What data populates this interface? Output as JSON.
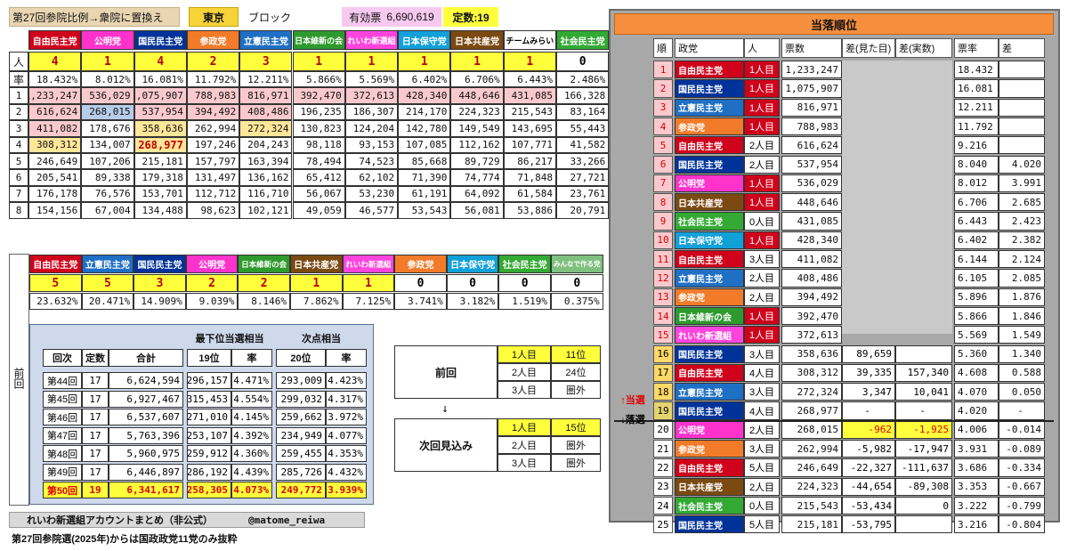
{
  "header": {
    "title": "第27回参院比例→衆院に置換え",
    "block_name": "東京",
    "block_suffix": "ブロック",
    "valid_label": "有効票",
    "valid_votes": "6,690,619",
    "seats_label": "定数:19"
  },
  "colors": {
    "自由民主党": "#d0021b",
    "公明党": "#ff33cc",
    "国民民主党": "#003399",
    "参政党": "#f27b2a",
    "立憲民主党": "#1f6fc4",
    "日本維新の会": "#2e9a2e",
    "れいわ新選組": "#ff44dd",
    "日本保守党": "#12a0d8",
    "日本共産党": "#7b4a12",
    "チームみらい": "#ffffff",
    "社会民主党": "#33aa33",
    "みんなで作る党": "#7fc07f"
  },
  "top_table": {
    "parties": [
      "自由民主党",
      "公明党",
      "国民民主党",
      "参政党",
      "立憲民主党",
      "日本維新の会",
      "れいわ新選組",
      "日本保守党",
      "日本共産党",
      "チームみらい",
      "社会民主党"
    ],
    "seats_label": "人",
    "seats": [
      "4",
      "1",
      "4",
      "2",
      "3",
      "1",
      "1",
      "1",
      "1",
      "1",
      "0"
    ],
    "rate_label": "率",
    "rates": [
      "18.432%",
      "8.012%",
      "16.081%",
      "11.792%",
      "12.211%",
      "5.866%",
      "5.569%",
      "6.402%",
      "6.706%",
      "6.443%",
      "2.486%"
    ],
    "rows": [
      {
        "n": "1",
        "v": [
          "1,233,247",
          "536,029",
          "1,075,907",
          "788,983",
          "816,971",
          "392,470",
          "372,613",
          "428,340",
          "448,646",
          "431,085",
          "166,328"
        ]
      },
      {
        "n": "2",
        "v": [
          "616,624",
          "268,015",
          "537,954",
          "394,492",
          "408,486",
          "196,235",
          "186,307",
          "214,170",
          "224,323",
          "215,543",
          "83,164"
        ]
      },
      {
        "n": "3",
        "v": [
          "411,082",
          "178,676",
          "358,636",
          "262,994",
          "272,324",
          "130,823",
          "124,204",
          "142,780",
          "149,549",
          "143,695",
          "55,443"
        ]
      },
      {
        "n": "4",
        "v": [
          "308,312",
          "134,007",
          "268,977",
          "197,246",
          "204,243",
          "98,118",
          "93,153",
          "107,085",
          "112,162",
          "107,771",
          "41,582"
        ]
      },
      {
        "n": "5",
        "v": [
          "246,649",
          "107,206",
          "215,181",
          "157,797",
          "163,394",
          "78,494",
          "74,523",
          "85,668",
          "89,729",
          "86,217",
          "33,266"
        ]
      },
      {
        "n": "6",
        "v": [
          "205,541",
          "89,338",
          "179,318",
          "131,497",
          "136,162",
          "65,412",
          "62,102",
          "71,390",
          "74,774",
          "71,848",
          "27,721"
        ]
      },
      {
        "n": "7",
        "v": [
          "176,178",
          "76,576",
          "153,701",
          "112,712",
          "116,710",
          "56,067",
          "53,230",
          "61,191",
          "64,092",
          "61,584",
          "23,761"
        ]
      },
      {
        "n": "8",
        "v": [
          "154,156",
          "67,004",
          "134,488",
          "98,623",
          "102,121",
          "49,059",
          "46,577",
          "53,543",
          "56,081",
          "53,886",
          "20,791"
        ]
      }
    ]
  },
  "prev_table": {
    "side_label": "前回",
    "parties": [
      "自由民主党",
      "立憲民主党",
      "国民民主党",
      "公明党",
      "日本維新の会",
      "日本共産党",
      "れいわ新選組",
      "参政党",
      "日本保守党",
      "社会民主党",
      "みんなで作る党"
    ],
    "seats": [
      "5",
      "5",
      "3",
      "2",
      "2",
      "1",
      "1",
      "0",
      "0",
      "0",
      "0"
    ],
    "rates": [
      "23.632%",
      "20.471%",
      "14.909%",
      "9.039%",
      "8.146%",
      "7.862%",
      "7.125%",
      "3.741%",
      "3.182%",
      "1.519%",
      "0.375%"
    ]
  },
  "history": {
    "h_round": "回次",
    "h_seats": "定数",
    "h_total": "合計",
    "h_group1": "最下位当選相当",
    "h_group2": "次点相当",
    "h_pos1": "19位",
    "h_rate1": "率",
    "h_pos2": "20位",
    "h_rate2": "率",
    "rows": [
      {
        "round": "第44回",
        "seats": "17",
        "total": "6,624,594",
        "v1": "296,157",
        "r1": "4.471%",
        "v2": "293,009",
        "r2": "4.423%"
      },
      {
        "round": "第45回",
        "seats": "17",
        "total": "6,927,467",
        "v1": "315,453",
        "r1": "4.554%",
        "v2": "299,032",
        "r2": "4.317%"
      },
      {
        "round": "第46回",
        "seats": "17",
        "total": "6,537,607",
        "v1": "271,010",
        "r1": "4.145%",
        "v2": "259,662",
        "r2": "3.972%"
      },
      {
        "round": "第47回",
        "seats": "17",
        "total": "5,763,396",
        "v1": "253,107",
        "r1": "4.392%",
        "v2": "234,949",
        "r2": "4.077%"
      },
      {
        "round": "第48回",
        "seats": "17",
        "total": "5,960,975",
        "v1": "259,912",
        "r1": "4.360%",
        "v2": "259,455",
        "r2": "4.353%"
      },
      {
        "round": "第49回",
        "seats": "17",
        "total": "6,446,897",
        "v1": "286,192",
        "r1": "4.439%",
        "v2": "285,726",
        "r2": "4.432%"
      },
      {
        "round": "第50回",
        "seats": "19",
        "total": "6,341,617",
        "v1": "258,305",
        "r1": "4.073%",
        "v2": "249,772",
        "r2": "3.939%"
      }
    ]
  },
  "comparison": {
    "prev_label": "前回",
    "next_label": "次回見込み",
    "arrow": "↓",
    "prev": [
      {
        "count": "1人目",
        "rank": "11位"
      },
      {
        "count": "2人目",
        "rank": "24位"
      },
      {
        "count": "3人目",
        "rank": "圏外"
      }
    ],
    "next": [
      {
        "count": "1人目",
        "rank": "15位"
      },
      {
        "count": "2人目",
        "rank": "圏外"
      },
      {
        "count": "3人目",
        "rank": "圏外"
      }
    ]
  },
  "footer": {
    "account": "れいわ新選組アカウントまとめ（非公式）",
    "handle": "@matome_reiwa",
    "note": "第27回参院選(2025年)からは国政政党11党のみ抜粋"
  },
  "ranking": {
    "title": "当落順位",
    "headers": {
      "rank": "順",
      "party": "政党",
      "person": "人",
      "votes": "票数",
      "diff_seen": "差(見た目)",
      "diff_real": "差(実数)",
      "rate": "票率",
      "diff": "差"
    },
    "win_label": "↑当選",
    "lose_label": "↓落選",
    "rows": [
      {
        "rank": "1",
        "party": "自由民主党",
        "person": "1人目",
        "votes": "1,233,247",
        "diff_seen": "",
        "diff_real": "",
        "rate": "18.432",
        "diff": ""
      },
      {
        "rank": "2",
        "party": "国民民主党",
        "person": "1人目",
        "votes": "1,075,907",
        "diff_seen": "",
        "diff_real": "",
        "rate": "16.081",
        "diff": ""
      },
      {
        "rank": "3",
        "party": "立憲民主党",
        "person": "1人目",
        "votes": "816,971",
        "diff_seen": "",
        "diff_real": "",
        "rate": "12.211",
        "diff": ""
      },
      {
        "rank": "4",
        "party": "参政党",
        "person": "1人目",
        "votes": "788,983",
        "diff_seen": "",
        "diff_real": "",
        "rate": "11.792",
        "diff": ""
      },
      {
        "rank": "5",
        "party": "自由民主党",
        "person": "2人目",
        "votes": "616,624",
        "diff_seen": "",
        "diff_real": "",
        "rate": "9.216",
        "diff": ""
      },
      {
        "rank": "6",
        "party": "国民民主党",
        "person": "2人目",
        "votes": "537,954",
        "diff_seen": "",
        "diff_real": "",
        "rate": "8.040",
        "diff": "4.020"
      },
      {
        "rank": "7",
        "party": "公明党",
        "person": "1人目",
        "votes": "536,029",
        "diff_seen": "",
        "diff_real": "",
        "rate": "8.012",
        "diff": "3.991"
      },
      {
        "rank": "8",
        "party": "日本共産党",
        "person": "1人目",
        "votes": "448,646",
        "diff_seen": "",
        "diff_real": "",
        "rate": "6.706",
        "diff": "2.685"
      },
      {
        "rank": "9",
        "party": "社会民主党",
        "person": "0人目",
        "votes": "431,085",
        "diff_seen": "",
        "diff_real": "",
        "rate": "6.443",
        "diff": "2.423"
      },
      {
        "rank": "10",
        "party": "日本保守党",
        "person": "1人目",
        "votes": "428,340",
        "diff_seen": "",
        "diff_real": "",
        "rate": "6.402",
        "diff": "2.382"
      },
      {
        "rank": "11",
        "party": "自由民主党",
        "person": "3人目",
        "votes": "411,082",
        "diff_seen": "",
        "diff_real": "",
        "rate": "6.144",
        "diff": "2.124"
      },
      {
        "rank": "12",
        "party": "立憲民主党",
        "person": "2人目",
        "votes": "408,486",
        "diff_seen": "",
        "diff_real": "",
        "rate": "6.105",
        "diff": "2.085"
      },
      {
        "rank": "13",
        "party": "参政党",
        "person": "2人目",
        "votes": "394,492",
        "diff_seen": "",
        "diff_real": "",
        "rate": "5.896",
        "diff": "1.876"
      },
      {
        "rank": "14",
        "party": "日本維新の会",
        "person": "1人目",
        "votes": "392,470",
        "diff_seen": "",
        "diff_real": "",
        "rate": "5.866",
        "diff": "1.846"
      },
      {
        "rank": "15",
        "party": "れいわ新選組",
        "person": "1人目",
        "votes": "372,613",
        "diff_seen": "",
        "diff_real": "",
        "rate": "5.569",
        "diff": "1.549"
      },
      {
        "rank": "16",
        "party": "国民民主党",
        "person": "3人目",
        "votes": "358,636",
        "diff_seen": "89,659",
        "diff_real": "",
        "rate": "5.360",
        "diff": "1.340"
      },
      {
        "rank": "17",
        "party": "自由民主党",
        "person": "4人目",
        "votes": "308,312",
        "diff_seen": "39,335",
        "diff_real": "157,340",
        "rate": "4.608",
        "diff": "0.588"
      },
      {
        "rank": "18",
        "party": "立憲民主党",
        "person": "3人目",
        "votes": "272,324",
        "diff_seen": "3,347",
        "diff_real": "10,041",
        "rate": "4.070",
        "diff": "0.050"
      },
      {
        "rank": "19",
        "party": "国民民主党",
        "person": "4人目",
        "votes": "268,977",
        "diff_seen": "-",
        "diff_real": "-",
        "rate": "4.020",
        "diff": "-"
      },
      {
        "rank": "20",
        "party": "公明党",
        "person": "2人目",
        "votes": "268,015",
        "diff_seen": "-962",
        "diff_real": "-1,925",
        "rate": "4.006",
        "diff": "-0.014"
      },
      {
        "rank": "21",
        "party": "参政党",
        "person": "3人目",
        "votes": "262,994",
        "diff_seen": "-5,982",
        "diff_real": "-17,947",
        "rate": "3.931",
        "diff": "-0.089"
      },
      {
        "rank": "22",
        "party": "自由民主党",
        "person": "5人目",
        "votes": "246,649",
        "diff_seen": "-22,327",
        "diff_real": "-111,637",
        "rate": "3.686",
        "diff": "-0.334"
      },
      {
        "rank": "23",
        "party": "日本共産党",
        "person": "2人目",
        "votes": "224,323",
        "diff_seen": "-44,654",
        "diff_real": "-89,308",
        "rate": "3.353",
        "diff": "-0.667"
      },
      {
        "rank": "24",
        "party": "社会民主党",
        "person": "0人目",
        "votes": "215,543",
        "diff_seen": "-53,434",
        "diff_real": "0",
        "rate": "3.222",
        "diff": "-0.799"
      },
      {
        "rank": "25",
        "party": "国民民主党",
        "person": "5人目",
        "votes": "215,181",
        "diff_seen": "-53,795",
        "diff_real": "",
        "rate": "3.216",
        "diff": "-0.804"
      }
    ]
  }
}
